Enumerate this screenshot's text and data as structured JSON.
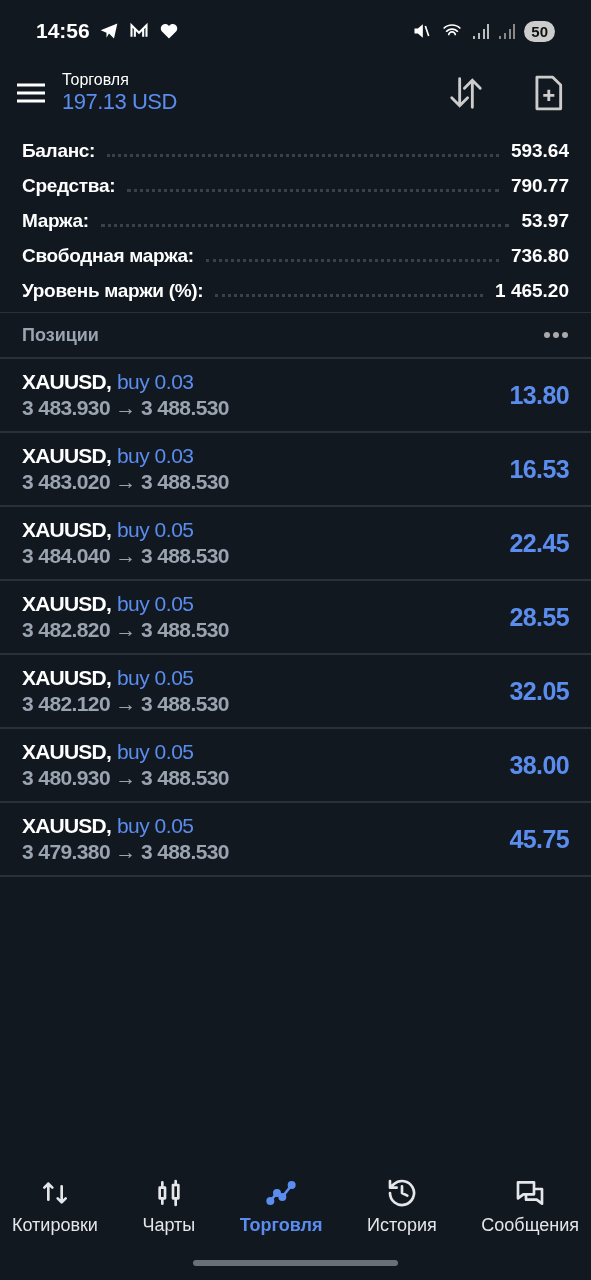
{
  "status_bar": {
    "time": "14:56",
    "battery": "50"
  },
  "header": {
    "title": "Торговля",
    "balance": "197.13 USD"
  },
  "summary": [
    {
      "label": "Баланс:",
      "value": "593.64"
    },
    {
      "label": "Средства:",
      "value": "790.77"
    },
    {
      "label": "Маржа:",
      "value": "53.97"
    },
    {
      "label": "Свободная маржа:",
      "value": "736.80"
    },
    {
      "label": "Уровень маржи (%):",
      "value": "1 465.20"
    }
  ],
  "positions_header": {
    "title": "Позиции"
  },
  "positions": [
    {
      "symbol": "XAUUSD,",
      "order": "buy 0.03",
      "prices": "3 483.930 → 3 488.530",
      "profit": "13.80"
    },
    {
      "symbol": "XAUUSD,",
      "order": "buy 0.03",
      "prices": "3 483.020 → 3 488.530",
      "profit": "16.53"
    },
    {
      "symbol": "XAUUSD,",
      "order": "buy 0.05",
      "prices": "3 484.040 → 3 488.530",
      "profit": "22.45"
    },
    {
      "symbol": "XAUUSD,",
      "order": "buy 0.05",
      "prices": "3 482.820 → 3 488.530",
      "profit": "28.55"
    },
    {
      "symbol": "XAUUSD,",
      "order": "buy 0.05",
      "prices": "3 482.120 → 3 488.530",
      "profit": "32.05"
    },
    {
      "symbol": "XAUUSD,",
      "order": "buy 0.05",
      "prices": "3 480.930 → 3 488.530",
      "profit": "38.00"
    },
    {
      "symbol": "XAUUSD,",
      "order": "buy 0.05",
      "prices": "3 479.380 → 3 488.530",
      "profit": "45.75"
    }
  ],
  "bottom_nav": [
    {
      "kind": "quotes",
      "label": "Котировки",
      "selected": false
    },
    {
      "kind": "charts",
      "label": "Чарты",
      "selected": false
    },
    {
      "kind": "trade",
      "label": "Торговля",
      "selected": true
    },
    {
      "kind": "history",
      "label": "История",
      "selected": false
    },
    {
      "kind": "messages",
      "label": "Сообщения",
      "selected": false
    }
  ]
}
